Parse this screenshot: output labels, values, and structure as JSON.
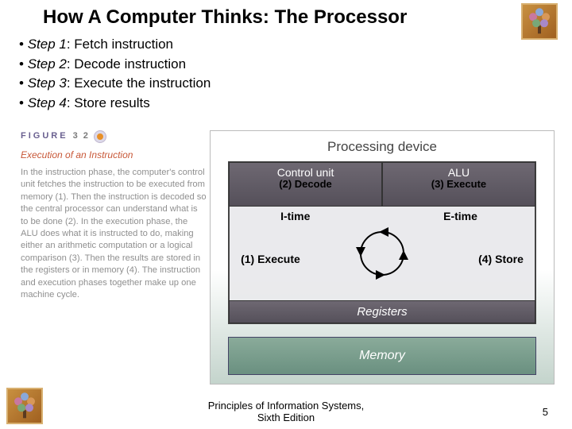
{
  "title": "How A Computer Thinks: The Processor",
  "steps": [
    {
      "label": "Step 1",
      "text": ": Fetch instruction"
    },
    {
      "label": "Step 2",
      "text": ": Decode instruction"
    },
    {
      "label": "Step 3",
      "text": ": Execute the instruction"
    },
    {
      "label": "Step 4",
      "text": ": Store results"
    }
  ],
  "figure": {
    "badge_word": "FIGURE",
    "badge_num": "3   2",
    "subtitle": "Execution of an Instruction",
    "body": "In the instruction phase, the computer's control unit fetches the instruction to be executed from memory (1). Then the instruction is decoded so the central processor can understand what is to be done (2). In the execution phase, the ALU does what it is instructed to do, making either an arithmetic computation or a logical comparison (3). Then the results are stored in the registers or in memory (4). The instruction and execution phases together make up one machine cycle."
  },
  "diagram": {
    "title": "Processing device",
    "control_unit": "Control unit",
    "decode": "(2) Decode",
    "alu": "ALU",
    "execute_step": "(3) Execute",
    "itime": "I-time",
    "etime": "E-time",
    "execute_label": "(1) Execute",
    "store_label": "(4) Store",
    "registers": "Registers",
    "memory": "Memory"
  },
  "footer_line1": "Principles of Information Systems,",
  "footer_line2": "Sixth Edition",
  "page_number": "5"
}
